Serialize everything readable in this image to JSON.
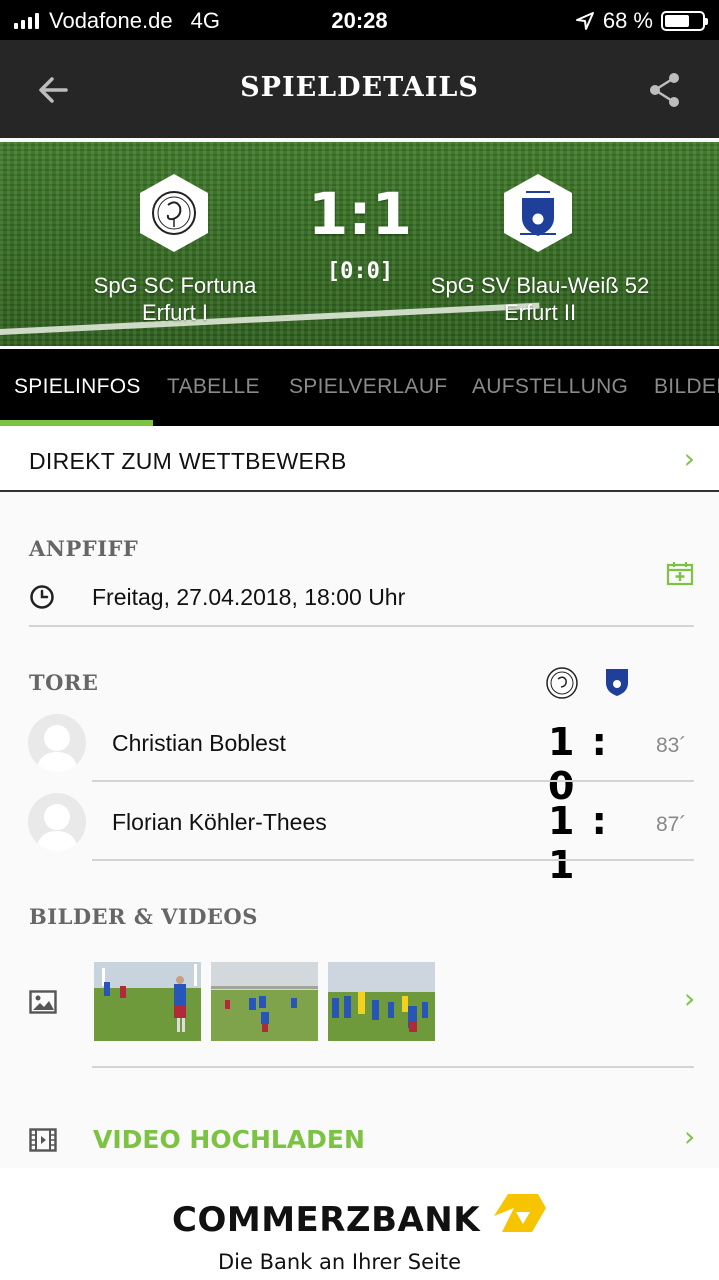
{
  "status_bar": {
    "carrier": "Vodafone.de",
    "network": "4G",
    "time": "20:28",
    "battery": "68 %",
    "battery_level": 0.68
  },
  "header": {
    "title": "SPIELDETAILS"
  },
  "match": {
    "home_team": "SpG SC Fortuna Erfurt I",
    "away_team": "SpG SV Blau-Weiß 52 Erfurt II",
    "score": "1:1",
    "halftime": "[0:0]"
  },
  "tabs": [
    {
      "label": "SPIELINFOS",
      "active": true
    },
    {
      "label": "TABELLE",
      "active": false
    },
    {
      "label": "SPIELVERLAUF",
      "active": false
    },
    {
      "label": "AUFSTELLUNG",
      "active": false
    },
    {
      "label": "BILDER",
      "active": false
    }
  ],
  "competition_link": {
    "label": "DIREKT ZUM WETTBEWERB"
  },
  "kickoff": {
    "heading": "ANPFIFF",
    "datetime": "Freitag, 27.04.2018, 18:00 Uhr"
  },
  "goals": {
    "heading": "TORE",
    "items": [
      {
        "player": "Christian Boblest",
        "score": "1 : 0",
        "minute": "83´"
      },
      {
        "player": "Florian Köhler-Thees",
        "score": "1 : 1",
        "minute": "87´"
      }
    ]
  },
  "media": {
    "heading": "BILDER & VIDEOS",
    "thumbnail_count": 3
  },
  "upload": {
    "label": "VIDEO HOCHLADEN"
  },
  "ad": {
    "brand": "COMMERZBANK",
    "slogan": "Die Bank an Ihrer Seite"
  },
  "colors": {
    "accent": "#7cc243",
    "header_bg": "#262626",
    "tabs_bg": "#000000",
    "commerzbank_yellow": "#f6c400"
  },
  "icons": [
    "back-arrow-icon",
    "share-icon",
    "clock-icon",
    "calendar-add-icon",
    "image-icon",
    "video-icon",
    "chevron-right-icon"
  ]
}
